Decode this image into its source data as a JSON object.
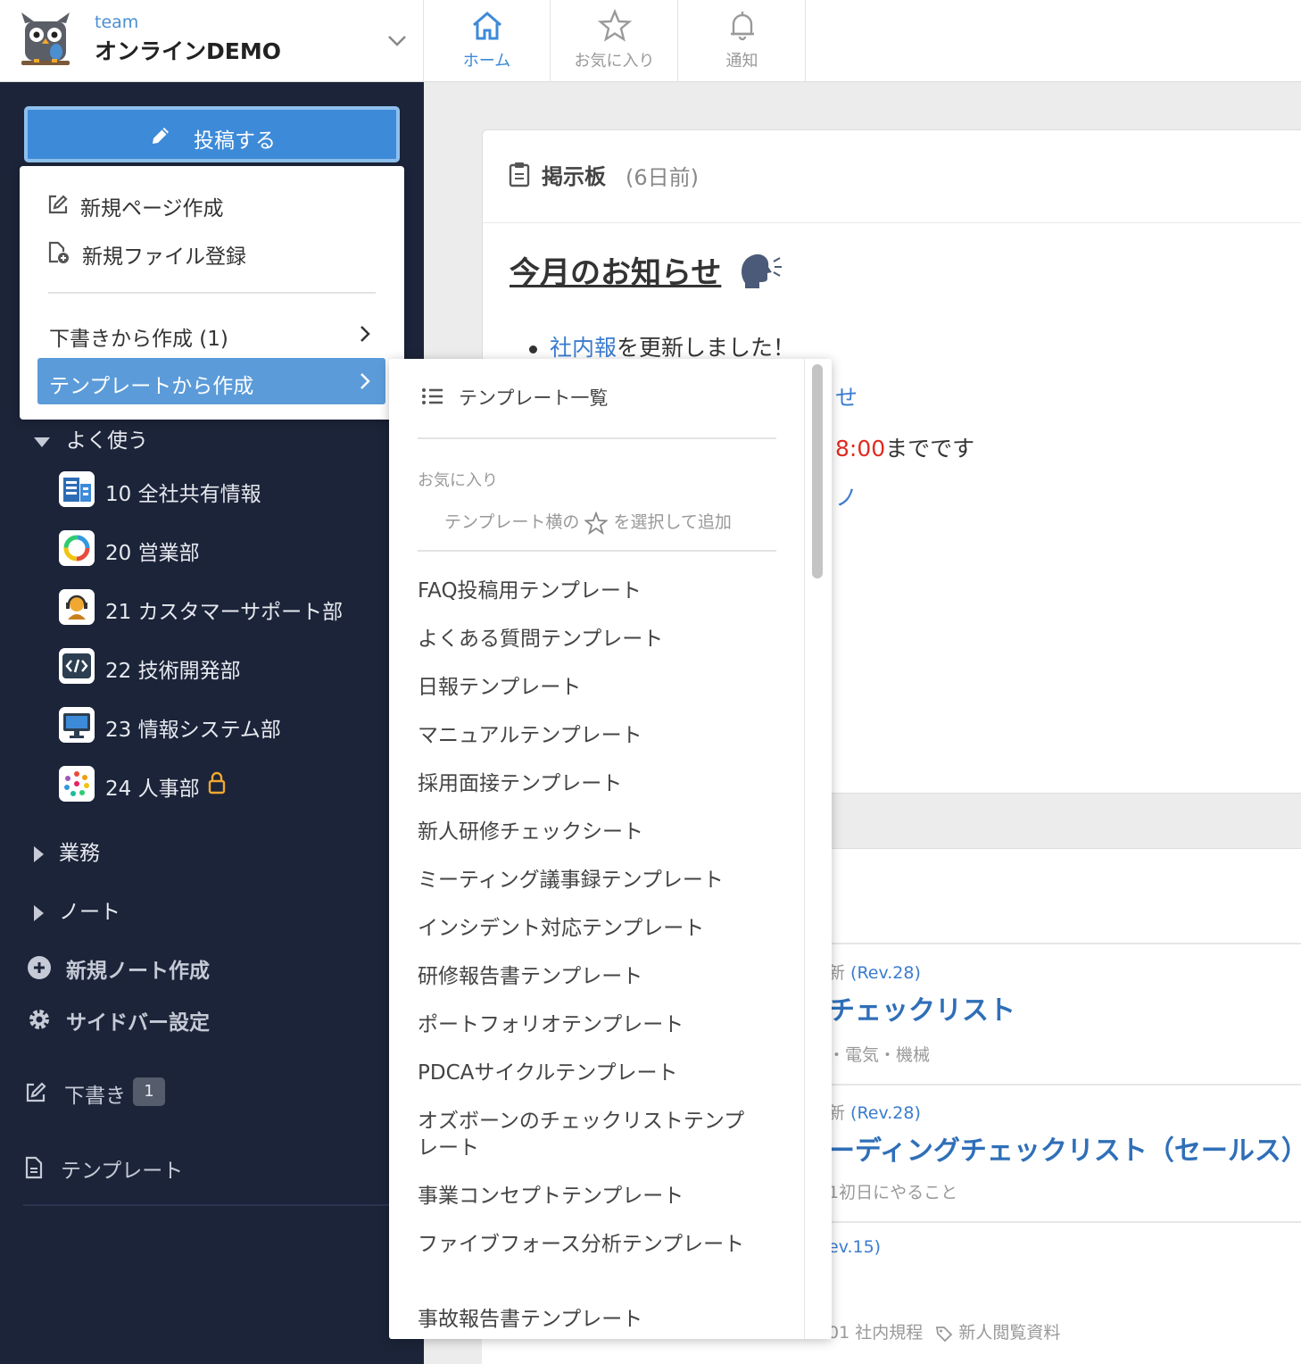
{
  "header": {
    "team_label": "team",
    "team_name": "オンラインDEMO",
    "nav": [
      {
        "label": "ホーム",
        "icon": "home-icon",
        "active": true
      },
      {
        "label": "お気に入り",
        "icon": "star-icon",
        "active": false
      },
      {
        "label": "通知",
        "icon": "bell-icon",
        "active": false
      }
    ]
  },
  "sidebar": {
    "post_button": "投稿する",
    "section_frequent": "よく使う",
    "groups": [
      {
        "label": "10 全社共有情報",
        "icon": "building-icon"
      },
      {
        "label": "20 営業部",
        "icon": "ring-icon"
      },
      {
        "label": "21 カスタマーサポート部",
        "icon": "support-agent-icon"
      },
      {
        "label": "22 技術開発部",
        "icon": "code-icon"
      },
      {
        "label": "23 情報システム部",
        "icon": "monitor-icon"
      },
      {
        "label": "24 人事部",
        "icon": "dots-circle-icon",
        "locked": true
      }
    ],
    "section_business": "業務",
    "section_notes": "ノート",
    "new_note": "新規ノート作成",
    "sidebar_settings": "サイドバー設定",
    "drafts_label": "下書き",
    "drafts_count": "1",
    "templates_label": "テンプレート"
  },
  "dropdown": {
    "new_page": "新規ページ作成",
    "new_file": "新規ファイル登録",
    "from_draft": "下書きから作成 (1)",
    "from_template": "テンプレートから作成"
  },
  "submenu": {
    "list_all": "テンプレート一覧",
    "favorites_label": "お気に入り",
    "favorites_hint_before": "テンプレート横の",
    "favorites_hint_after": "を選択して追加",
    "templates": [
      "FAQ投稿用テンプレート",
      "よくある質問テンプレート",
      "日報テンプレート",
      "マニュアルテンプレート",
      "採用面接テンプレート",
      "新人研修チェックシート",
      "ミーティング議事録テンプレート",
      "インシデント対応テンプレート",
      "研修報告書テンプレート",
      "ポートフォリオテンプレート",
      "PDCAサイクルテンプレート",
      "オズボーンのチェックリストテンプレート",
      "事業コンセプトテンプレート",
      "ファイブフォース分析テンプレート",
      "事故報告書テンプレート"
    ]
  },
  "board": {
    "title": "掲示板",
    "age": "(6日前)",
    "announce_title": "今月のお知らせ",
    "bullet_link": "社内報",
    "bullet_text": "を更新しました！",
    "peek1": "せ",
    "peek2_red": "8:00",
    "peek2_rest": "までです",
    "peek3": "ノ"
  },
  "documents": [
    {
      "rev_prefix": "新 ",
      "rev": "(Rev.28)",
      "title": "チェックリスト",
      "tags": "・電気・機械"
    },
    {
      "rev_prefix": "新 ",
      "rev": "(Rev.28)",
      "title": "ーディングチェックリスト（セールス）",
      "tags": "1初日にやること"
    },
    {
      "rev_prefix": "",
      "rev": "ev.15)",
      "title": "",
      "tags": "01 社内規程",
      "tag2": "新人閲覧資料"
    }
  ]
}
